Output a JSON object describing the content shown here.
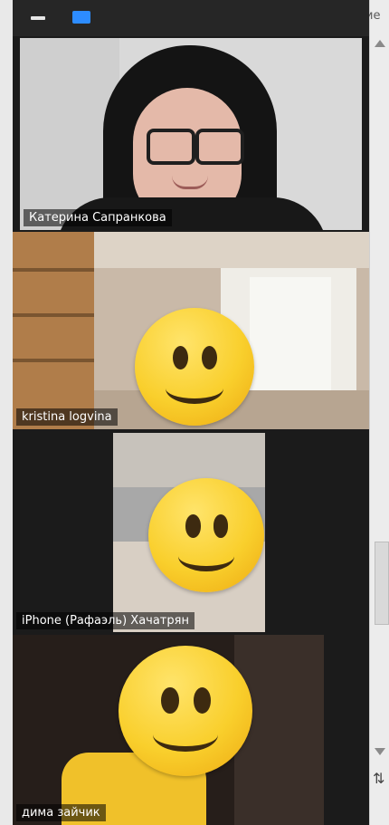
{
  "window": {
    "minimize_icon": "minimize-icon",
    "view_icon": "gallery-view-icon",
    "background_text": "ие"
  },
  "participants": [
    {
      "name": "Катерина Сапранкова",
      "video": "camera-on"
    },
    {
      "name": "kristina logvina",
      "video": "camera-on"
    },
    {
      "name": "iPhone (Рафаэль) Хачатрян",
      "video": "camera-on"
    },
    {
      "name": "дима зайчик",
      "video": "camera-on"
    }
  ],
  "colors": {
    "accent": "#2d8cff",
    "panel_bg": "#1b1b1b",
    "label_bg": "rgba(0,0,0,0.55)"
  }
}
